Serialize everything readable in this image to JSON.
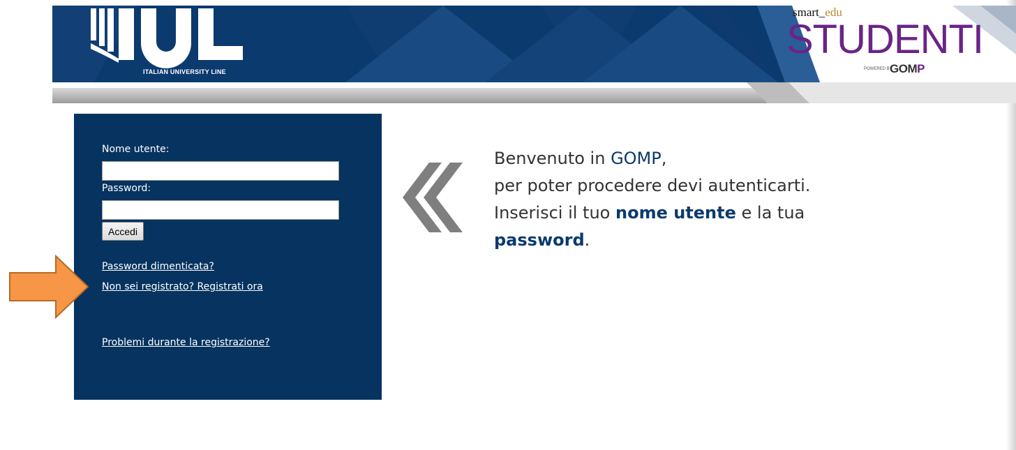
{
  "header": {
    "logo_text": "IUL",
    "logo_sub": "ITALIAN UNIVERSITY LINE",
    "brand_top_a": "smart_",
    "brand_top_b": "edu",
    "brand_main": "STUDENTI",
    "brand_powered": "POWERED BY",
    "brand_gomp_a": "GOM",
    "brand_gomp_b": "P"
  },
  "login": {
    "username_label": "Nome utente:",
    "username_value": "",
    "password_label": "Password:",
    "password_value": "",
    "submit_label": "Accedi",
    "forgot_link": "Password dimenticata?",
    "register_link": "Non sei registrato? Registrati ora",
    "problems_link": "Problemi durante la registrazione?"
  },
  "welcome": {
    "line1_a": "Benvenuto in ",
    "line1_b": "GOMP",
    "line1_c": ",",
    "line2": "per poter procedere devi autenticarti.",
    "line3_a": "Inserisci il tuo ",
    "line3_b": "nome utente",
    "line3_c": " e la tua",
    "line4_a": "password",
    "line4_b": "."
  },
  "colors": {
    "navy": "#06335f",
    "header_blue": "#0b3a6e",
    "accent_orange": "#f79646",
    "brand_purple": "#6a2487"
  }
}
